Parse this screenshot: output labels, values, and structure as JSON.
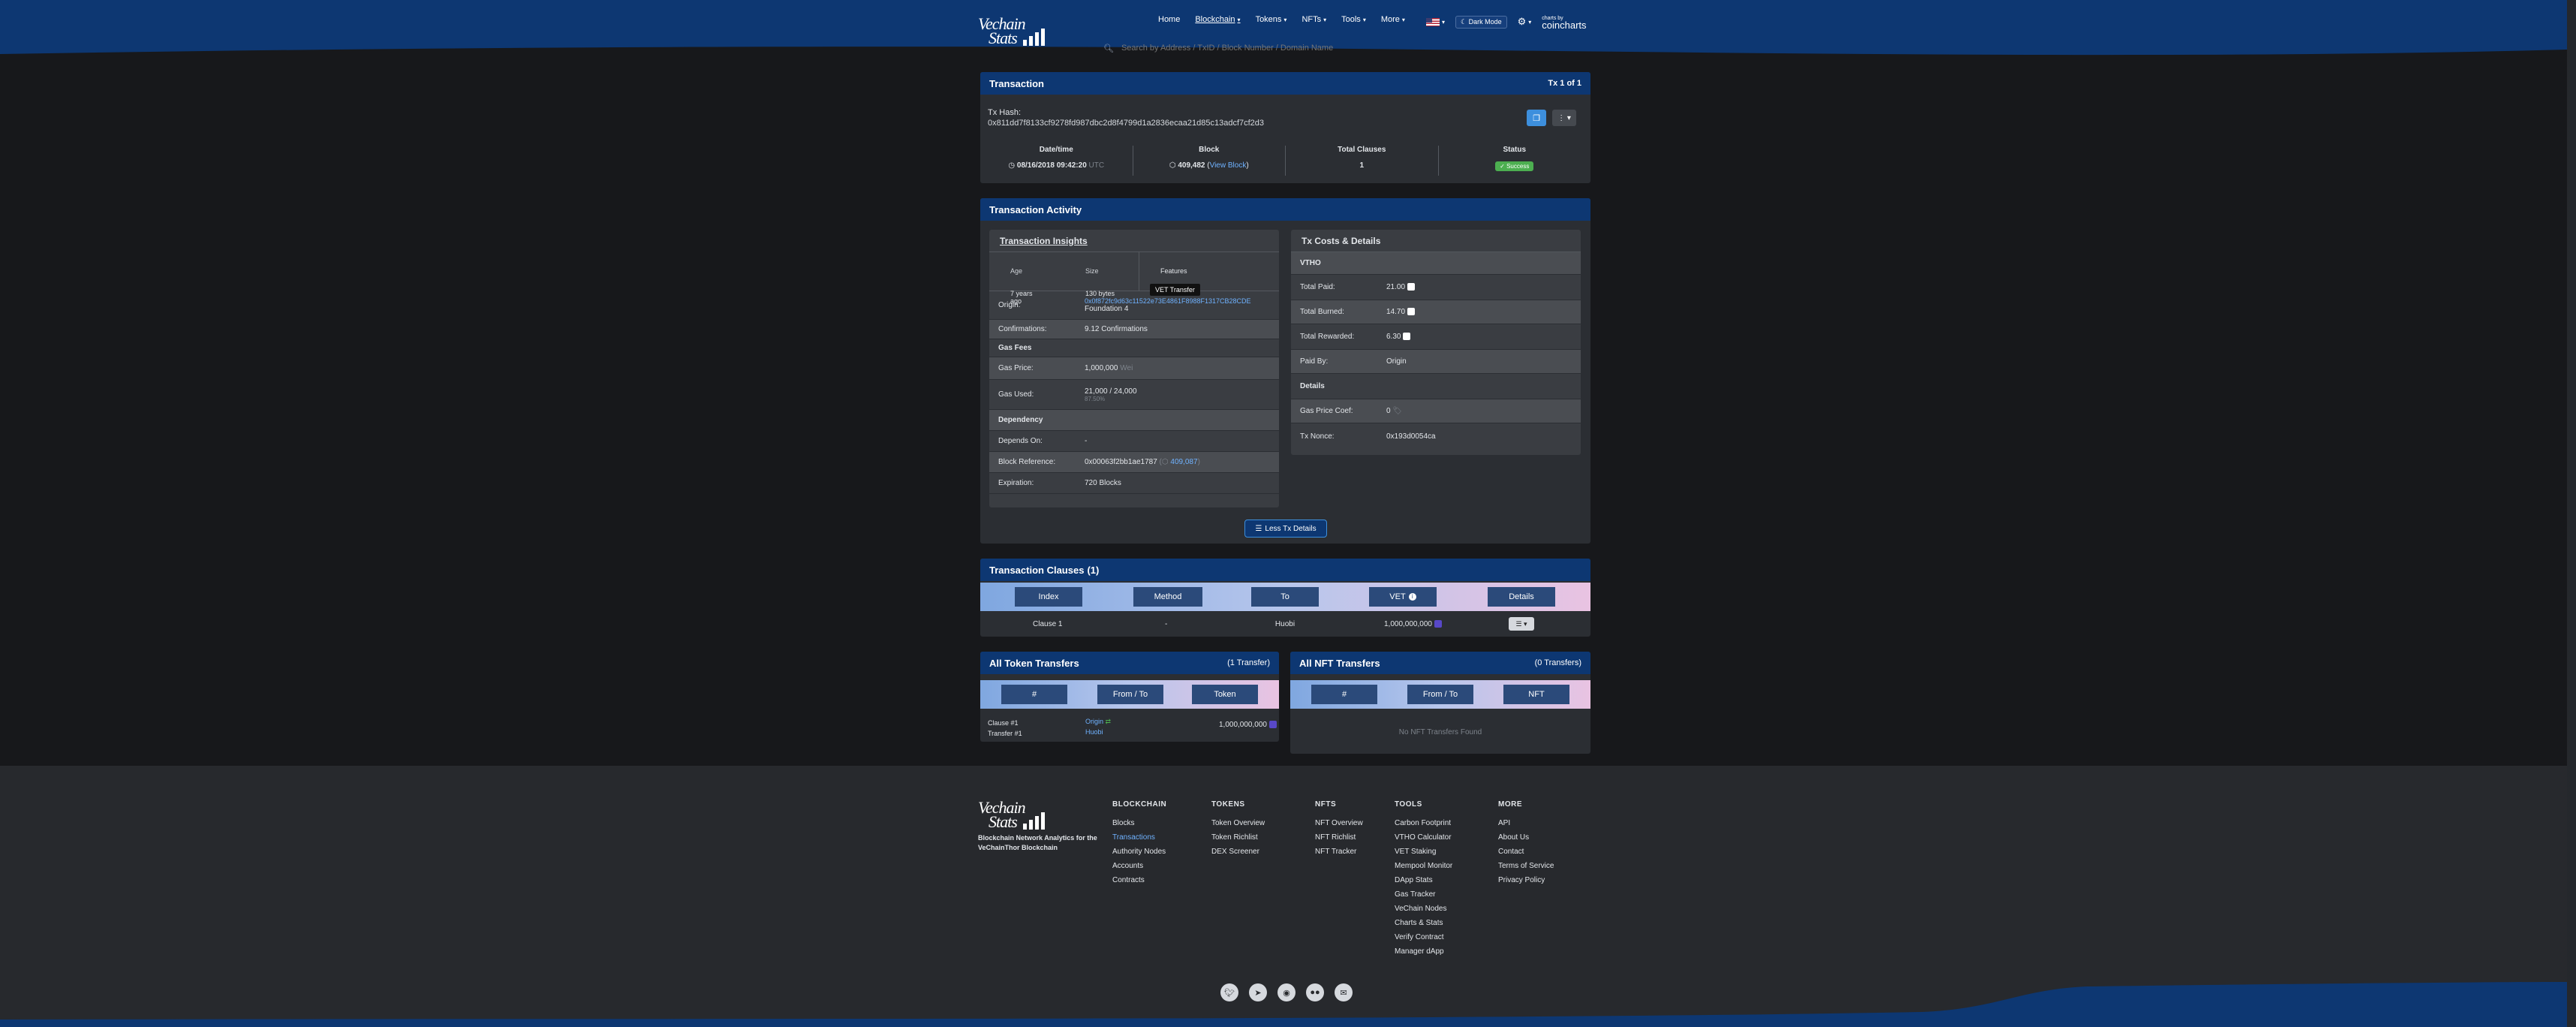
{
  "brand": {
    "logo_line1": "Vechain",
    "logo_line2": "Stats"
  },
  "nav": [
    {
      "label": "Home",
      "dropdown": false,
      "active": false
    },
    {
      "label": "Blockchain",
      "dropdown": true,
      "active": true
    },
    {
      "label": "Tokens",
      "dropdown": true,
      "active": false
    },
    {
      "label": "NFTs",
      "dropdown": true,
      "active": false
    },
    {
      "label": "Tools",
      "dropdown": true,
      "active": false
    },
    {
      "label": "More",
      "dropdown": true,
      "active": false
    }
  ],
  "header_right": {
    "dark_mode": "Dark Mode",
    "cmc_small": "charts by",
    "cmc_big": "coincharts"
  },
  "search": {
    "placeholder": "Search by Address / TxID / Block Number / Domain Name"
  },
  "transaction": {
    "title": "Transaction",
    "counter": "Tx 1 of 1",
    "hash_label": "Tx Hash:",
    "hash": "0x811dd7f8133cf9278fd987dbc2d8f4799d1a2836ecaa21d85c13adcf7cf2d3",
    "datetime_label": "Date/time",
    "datetime": "08/16/2018 09:42:20",
    "tz": "UTC",
    "block_label": "Block",
    "block": "409,482",
    "view_block": "View Block",
    "clauses_label": "Total Clauses",
    "clauses": "1",
    "status_label": "Status",
    "status": "Success"
  },
  "activity": {
    "title": "Transaction Activity",
    "insights_title": "Transaction Insights",
    "age_label": "Age",
    "age": "7 years ago",
    "size_label": "Size",
    "size": "130 bytes",
    "features_label": "Features",
    "feature_tag": "VET Transfer",
    "origin_label": "Origin:",
    "origin_addr": "0x0f872fc9d63c11522e73E4861F8988F1317CB28CDE",
    "origin_name": "Foundation 4",
    "confirmations_label": "Confirmations:",
    "confirmations": "9.12 Confirmations",
    "gas_fees_label": "Gas Fees",
    "gas_price_label": "Gas Price:",
    "gas_price": "1,000,000",
    "gas_price_unit": "Wei",
    "gas_used_label": "Gas Used:",
    "gas_used": "21,000 / 24,000",
    "gas_used_pct": "87.50%",
    "dependency_label": "Dependency",
    "depends_on_label": "Depends On:",
    "depends_on": "-",
    "block_ref_label": "Block Reference:",
    "block_ref": "0x00063f2bb1ae1787",
    "block_ref_num": "409,087",
    "expiration_label": "Expiration:",
    "expiration": "720 Blocks",
    "costs_title": "Tx Costs & Details",
    "vtho_label": "VTHO",
    "total_paid_label": "Total Paid:",
    "total_paid": "21.00",
    "total_burned_label": "Total Burned:",
    "total_burned": "14.70",
    "total_rewarded_label": "Total Rewarded:",
    "total_rewarded": "6.30",
    "paid_by_label": "Paid By:",
    "paid_by": "Origin",
    "details_label": "Details",
    "gas_coef_label": "Gas Price Coef:",
    "gas_coef": "0",
    "tx_nonce_label": "Tx Nonce:",
    "tx_nonce": "0x193d0054ca",
    "less_button": "Less Tx Details"
  },
  "clauses": {
    "title": "Transaction Clauses",
    "count": "(1)",
    "headers": [
      "Index",
      "Method",
      "To",
      "VET",
      "Details"
    ],
    "rows": [
      {
        "index": "Clause 1",
        "method": "-",
        "to": "Huobi",
        "vet": "1,000,000,000"
      }
    ]
  },
  "token_transfers": {
    "title": "All Token Transfers",
    "count": "(1 Transfer)",
    "headers": [
      "#",
      "From / To",
      "Token"
    ],
    "rows": [
      {
        "clause": "Clause #1",
        "transfer": "Transfer #1",
        "from": "Origin",
        "to": "Huobi",
        "amount": "1,000,000,000"
      }
    ]
  },
  "nft_transfers": {
    "title": "All NFT Transfers",
    "count": "(0 Transfers)",
    "headers": [
      "#",
      "From / To",
      "NFT"
    ],
    "empty": "No NFT Transfers Found"
  },
  "footer": {
    "tagline": "Blockchain Network Analytics for the VeChainThor Blockchain",
    "columns": [
      {
        "heading": "BLOCKCHAIN",
        "links": [
          "Blocks",
          "Transactions",
          "Authority Nodes",
          "Accounts",
          "Contracts"
        ]
      },
      {
        "heading": "TOKENS",
        "links": [
          "Token Overview",
          "Token Richlist",
          "DEX Screener"
        ]
      },
      {
        "heading": "NFTS",
        "links": [
          "NFT Overview",
          "NFT Richlist",
          "NFT Tracker"
        ]
      },
      {
        "heading": "TOOLS",
        "links": [
          "Carbon Footprint",
          "VTHO Calculator",
          "VET Staking",
          "Mempool Monitor",
          "DApp Stats",
          "Gas Tracker",
          "VeChain Nodes",
          "Charts & Stats",
          "Verify Contract",
          "Manager dApp"
        ]
      },
      {
        "heading": "MORE",
        "links": [
          "API",
          "About Us",
          "Contact",
          "Terms of Service",
          "Privacy Policy"
        ]
      }
    ],
    "social_icons": [
      "twitter-icon",
      "telegram-icon",
      "discord-icon",
      "flickr-icon",
      "email-icon"
    ]
  }
}
